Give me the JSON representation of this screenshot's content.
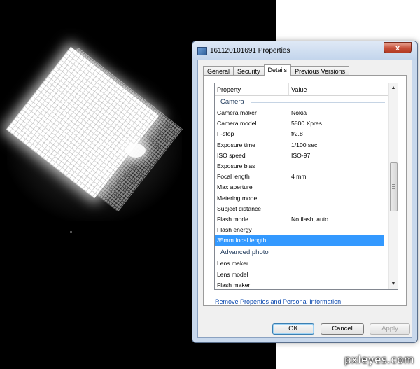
{
  "dialog": {
    "title": "161120101691 Properties",
    "close_label": "x",
    "tabs": [
      {
        "label": "General",
        "active": false
      },
      {
        "label": "Security",
        "active": false
      },
      {
        "label": "Details",
        "active": true
      },
      {
        "label": "Previous Versions",
        "active": false
      }
    ],
    "columns": {
      "property": "Property",
      "value": "Value"
    },
    "groups": {
      "camera": {
        "label": "Camera",
        "rows": [
          {
            "k": "Camera maker",
            "v": "Nokia"
          },
          {
            "k": "Camera model",
            "v": "5800 Xpres"
          },
          {
            "k": "F-stop",
            "v": "f/2.8"
          },
          {
            "k": "Exposure time",
            "v": "1/100 sec."
          },
          {
            "k": "ISO speed",
            "v": "ISO-97"
          },
          {
            "k": "Exposure bias",
            "v": ""
          },
          {
            "k": "Focal length",
            "v": "4 mm"
          },
          {
            "k": "Max aperture",
            "v": ""
          },
          {
            "k": "Metering mode",
            "v": ""
          },
          {
            "k": "Subject distance",
            "v": ""
          },
          {
            "k": "Flash mode",
            "v": "No flash, auto"
          },
          {
            "k": "Flash energy",
            "v": ""
          },
          {
            "k": "35mm focal length",
            "v": ""
          }
        ]
      },
      "advanced": {
        "label": "Advanced photo",
        "rows": [
          {
            "k": "Lens maker",
            "v": ""
          },
          {
            "k": "Lens model",
            "v": ""
          },
          {
            "k": "Flash maker",
            "v": ""
          }
        ]
      }
    },
    "scroll_up": "▲",
    "scroll_down": "▼",
    "remove_link": "Remove Properties and Personal Information",
    "buttons": {
      "ok": "OK",
      "cancel": "Cancel",
      "apply": "Apply"
    }
  },
  "watermark": "pxleyes.com",
  "colors": {
    "selection": "#3399ff",
    "link": "#0645ad",
    "close": "#c7503a"
  }
}
